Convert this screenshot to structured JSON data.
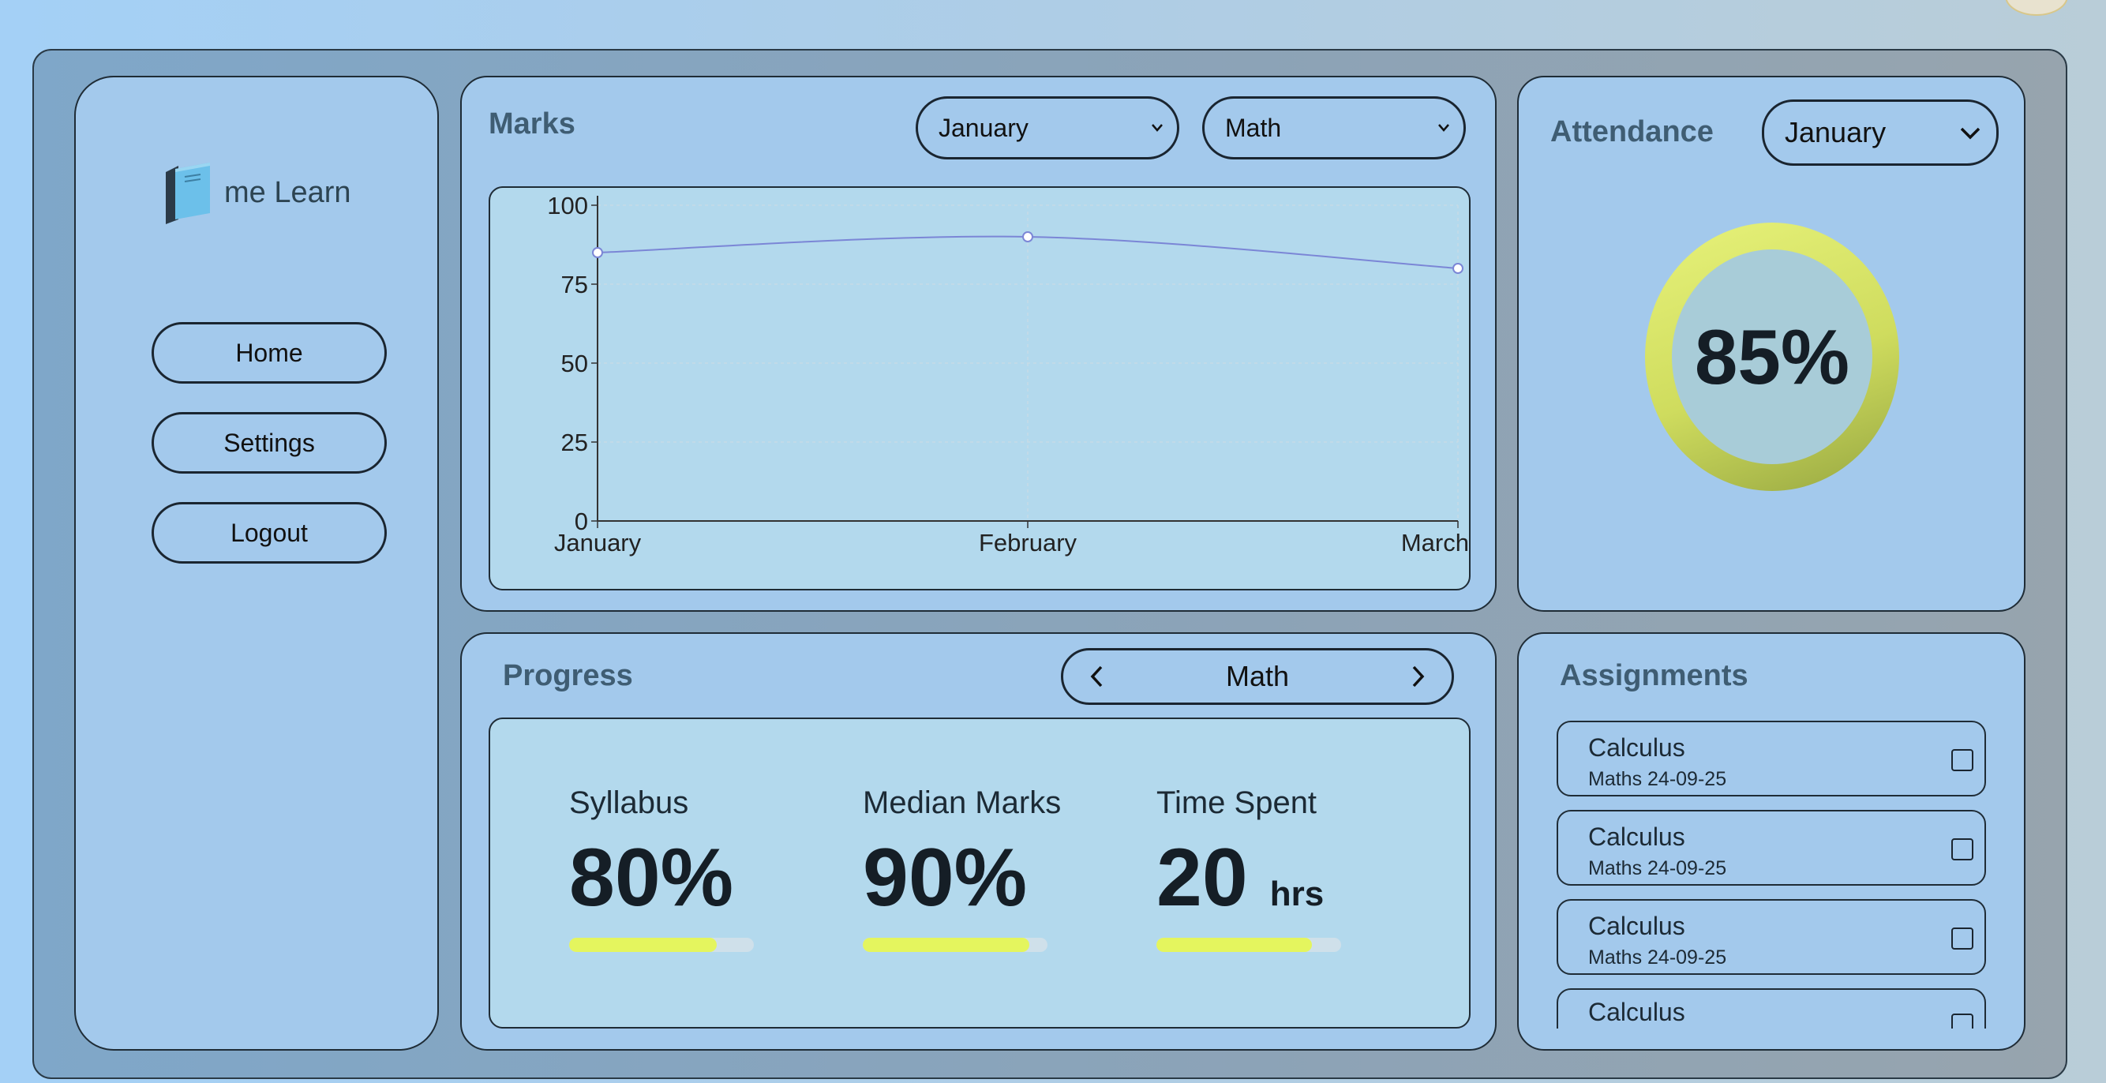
{
  "app": {
    "name": "me Learn"
  },
  "sidebar": {
    "items": [
      {
        "label": "Home"
      },
      {
        "label": "Settings"
      },
      {
        "label": "Logout"
      }
    ]
  },
  "marks": {
    "title": "Marks",
    "month_select": "January",
    "subject_select": "Math"
  },
  "attendance": {
    "title": "Attendance",
    "month_select": "January",
    "value": "85%",
    "fraction": 0.85
  },
  "progress": {
    "title": "Progress",
    "subject": "Math",
    "stats": [
      {
        "label": "Syllabus",
        "value": "80%",
        "unit": "",
        "fill": 0.8
      },
      {
        "label": "Median Marks",
        "value": "90%",
        "unit": "",
        "fill": 0.9
      },
      {
        "label": "Time Spent",
        "value": "20",
        "unit": "hrs",
        "fill": 0.84
      }
    ]
  },
  "assignments": {
    "title": "Assignments",
    "items": [
      {
        "title": "Calculus",
        "subtitle": "Maths 24-09-25"
      },
      {
        "title": "Calculus",
        "subtitle": "Maths 24-09-25"
      },
      {
        "title": "Calculus",
        "subtitle": "Maths 24-09-25"
      },
      {
        "title": "Calculus",
        "subtitle": ""
      }
    ]
  },
  "colors": {
    "accent": "#e4f55e",
    "line": "#7b86d6",
    "panel": "#a3c9ec"
  },
  "chart_data": {
    "type": "line",
    "categories": [
      "January",
      "February",
      "March"
    ],
    "values": [
      85,
      90,
      80
    ],
    "ylim": [
      0,
      100
    ],
    "yticks": [
      "0",
      "25",
      "50",
      "75",
      "100"
    ],
    "grid": true
  }
}
